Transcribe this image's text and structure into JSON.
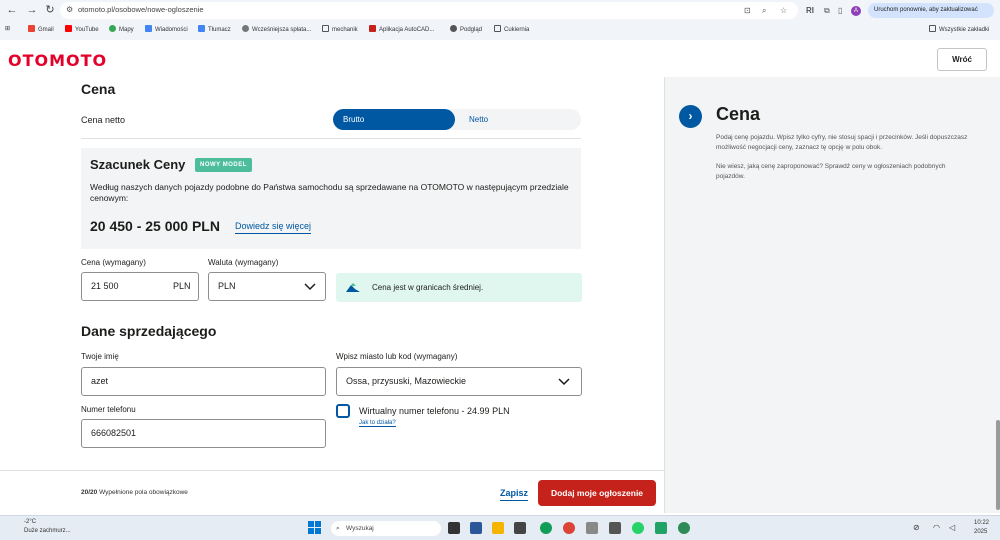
{
  "browser": {
    "url": "otomoto.pl/osobowe/nowe-ogloszenie",
    "avatar_letter": "A",
    "restart_text": "Uruchom ponownie, aby zaktualizować",
    "bookmarks": [
      "Gmail",
      "YouTube",
      "Mapy",
      "Wiadomości",
      "Tłumacz",
      "Wcześniejsza spłata...",
      "mechanik",
      "Aplikacja AutoCAD...",
      "Podgląd",
      "Cukiernia"
    ],
    "all_bookmarks": "Wszystkie zakładki"
  },
  "header": {
    "logo": "OTOMOTO",
    "login_label": "Wróć"
  },
  "price_section": {
    "title": "Cena",
    "net_label": "Cena netto",
    "toggle_brutto": "Brutto",
    "toggle_netto": "Netto",
    "estimate": {
      "title": "Szacunek Ceny",
      "badge": "NOWY MODEL",
      "description": "Według naszych danych pojazdy podobne do Państwa samochodu są sprzedawane na OTOMOTO w następującym przedziale cenowym:",
      "range": "20 450 - 25 000 PLN",
      "link": "Dowiedz się więcej"
    },
    "price_label": "Cena (wymagany)",
    "price_value": "21 500",
    "price_unit": "PLN",
    "currency_label": "Waluta (wymagany)",
    "currency_value": "PLN",
    "info_text": "Cena jest w granicach średniej."
  },
  "seller_section": {
    "title": "Dane sprzedającego",
    "name_label": "Twoje imię",
    "name_value": "azet",
    "city_label": "Wpisz miasto lub kod (wymagany)",
    "city_value": "Ossa, przysuski, Mazowieckie",
    "phone_label": "Numer telefonu",
    "phone_value": "666082501",
    "virtual_label": "Wirtualny numer telefonu - 24.99 PLN",
    "virtual_link": "Jak to działa?"
  },
  "footer": {
    "progress_count": "20/20",
    "progress_text": "Wypełnione pola obowiązkowe",
    "save_label": "Zapisz",
    "submit_label": "Dodaj moje ogłoszenie"
  },
  "sidebar": {
    "title": "Cena",
    "text1": "Podaj cenę pojazdu. Wpisz tylko cyfry, nie stosuj spacji i przecinków. Jeśli dopuszczasz możliwość negocjacji ceny, zaznacz tę opcję w polu obok.",
    "text2": "Nie wiesz, jaką cenę zaproponować? Sprawdź ceny w ogłoszeniach podobnych pojazdów."
  },
  "taskbar": {
    "weather": "Duże zachmurz...",
    "weather_temp": "-2°C",
    "search_placeholder": "Wyszukaj",
    "time": "10:22",
    "date": "2025"
  },
  "colors": {
    "brand_red": "#e4002b",
    "primary_blue": "#0058a3",
    "submit_red": "#c4221a",
    "badge_green": "#4dbd9c"
  }
}
